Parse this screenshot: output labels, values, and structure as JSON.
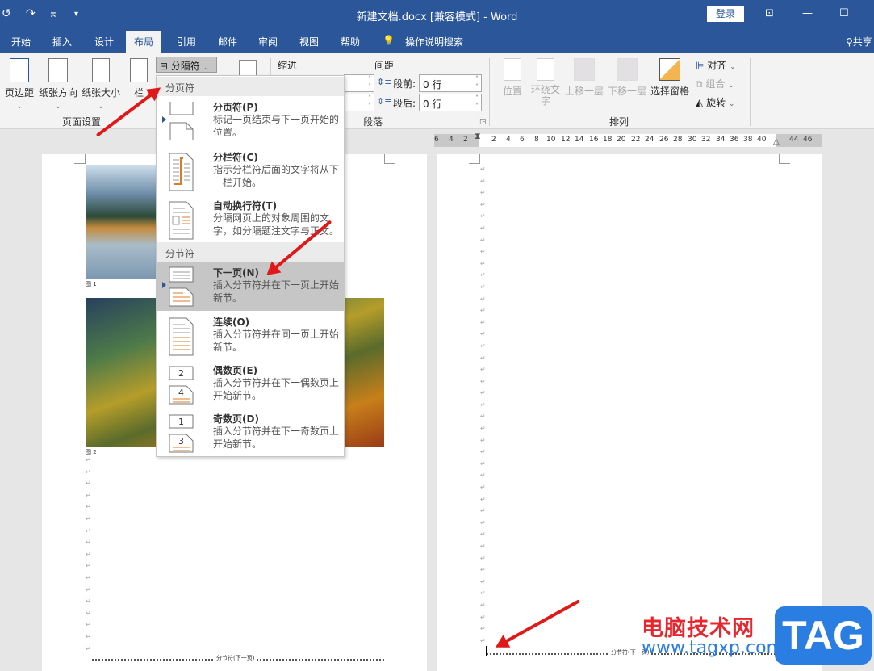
{
  "titlebar": {
    "title": "新建文档.docx [兼容模式] - Word",
    "login_label": "登录",
    "undo_icon": "↺",
    "redo_icon": "↷",
    "customize_icon": "⌅",
    "ribbon_display_icon": "⊡",
    "minimize_icon": "—",
    "maximize_icon": "☐"
  },
  "tabs": [
    {
      "label": "开始"
    },
    {
      "label": "插入"
    },
    {
      "label": "设计"
    },
    {
      "label": "布局",
      "active": true
    },
    {
      "label": "引用"
    },
    {
      "label": "邮件"
    },
    {
      "label": "审阅"
    },
    {
      "label": "视图"
    },
    {
      "label": "帮助"
    },
    {
      "label": "操作说明搜索"
    }
  ],
  "share_label": "共享",
  "ribbon": {
    "page_setup": {
      "group_label": "页面设置",
      "margins": "页边距",
      "orientation": "纸张方向",
      "size": "纸张大小",
      "columns": "栏",
      "breaks": "分隔符"
    },
    "paragraph": {
      "group_label": "段落",
      "indent_label": "缩进",
      "spacing_label": "间距",
      "before_label": "段前:",
      "before_value": "0 行",
      "after_label": "段后:",
      "after_value": "0 行"
    },
    "arrange": {
      "group_label": "排列",
      "position": "位置",
      "wrap_text": "环绕文字",
      "bring_forward": "上移一层",
      "send_backward": "下移一层",
      "selection_pane": "选择窗格",
      "align": "对齐",
      "group": "组合",
      "rotate": "旋转"
    }
  },
  "breaks_menu": {
    "page_breaks_header": "分页符",
    "section_breaks_header": "分节符",
    "items": [
      {
        "title": "分页符(P)",
        "desc": "标记一页结束与下一页开始的位置。"
      },
      {
        "title": "分栏符(C)",
        "desc": "指示分栏符后面的文字将从下一栏开始。"
      },
      {
        "title": "自动换行符(T)",
        "desc": "分隔网页上的对象周围的文字，如分隔题注文字与正文。"
      },
      {
        "title": "下一页(N)",
        "desc": "插入分节符并在下一页上开始新节。",
        "highlighted": true
      },
      {
        "title": "连续(O)",
        "desc": "插入分节符并在同一页上开始新节。"
      },
      {
        "title": "偶数页(E)",
        "desc": "插入分节符并在下一偶数页上开始新节。"
      },
      {
        "title": "奇数页(D)",
        "desc": "插入分节符并在下一奇数页上开始新节。"
      }
    ]
  },
  "ruler": {
    "left_ticks": [
      "6",
      "4",
      "2"
    ],
    "ticks": [
      "2",
      "4",
      "6",
      "8",
      "10",
      "12",
      "14",
      "16",
      "18",
      "20",
      "22",
      "24",
      "26",
      "28",
      "30",
      "32",
      "34",
      "36",
      "38",
      "40"
    ],
    "right_ticks": [
      "44",
      "46"
    ]
  },
  "document": {
    "caption1": "图 1",
    "caption2": "图 2",
    "section_break_label": "分节符(下一页)",
    "section_break_label_page2": "分节符(下一页)"
  },
  "watermark": {
    "site_name": "电脑技术网",
    "url": "www.tagxp.com",
    "tag": "TAG"
  }
}
